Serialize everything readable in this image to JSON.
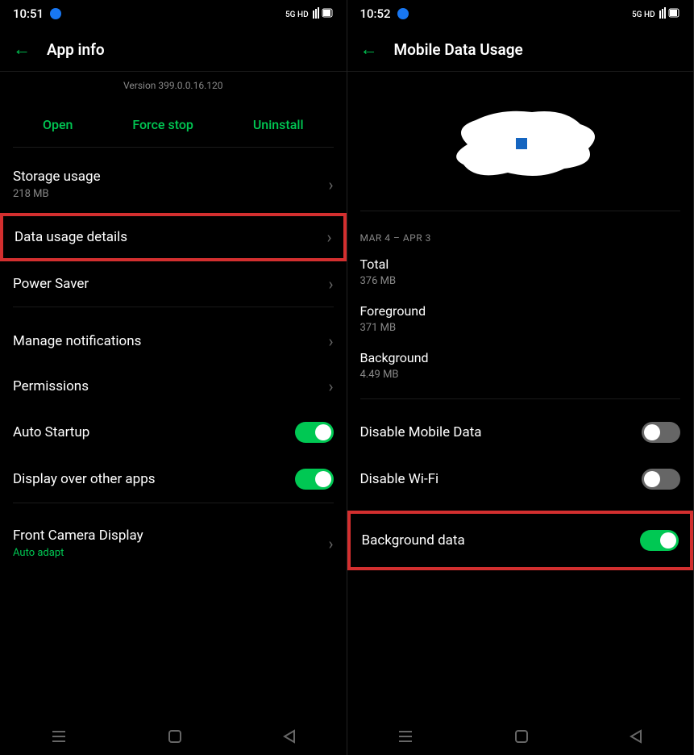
{
  "left": {
    "status": {
      "time": "10:51",
      "signal": "⁵⁴ᴳ ᴴᴰ ⫫⫫ 𝍠"
    },
    "header": {
      "title": "App info"
    },
    "version": "Version 399.0.0.16.120",
    "actions": {
      "open": "Open",
      "force_stop": "Force stop",
      "uninstall": "Uninstall"
    },
    "rows": {
      "storage": {
        "label": "Storage usage",
        "value": "218 MB"
      },
      "data_usage": {
        "label": "Data usage details"
      },
      "power_saver": {
        "label": "Power Saver"
      },
      "notifications": {
        "label": "Manage notifications"
      },
      "permissions": {
        "label": "Permissions"
      },
      "auto_startup": {
        "label": "Auto Startup"
      },
      "display_over": {
        "label": "Display over other apps"
      },
      "front_camera": {
        "label": "Front Camera Display",
        "value": "Auto adapt"
      }
    }
  },
  "right": {
    "status": {
      "time": "10:52",
      "signal": "⁵⁴ᴳ ᴴᴰ ⫫⫫ 𝍠"
    },
    "header": {
      "title": "Mobile Data Usage"
    },
    "date_range": "MAR 4 – APR 3",
    "stats": {
      "total": {
        "label": "Total",
        "value": "376 MB"
      },
      "foreground": {
        "label": "Foreground",
        "value": "371 MB"
      },
      "background": {
        "label": "Background",
        "value": "4.49 MB"
      }
    },
    "toggles": {
      "disable_mobile": {
        "label": "Disable Mobile Data"
      },
      "disable_wifi": {
        "label": "Disable Wi-Fi"
      },
      "background_data": {
        "label": "Background data"
      }
    }
  }
}
